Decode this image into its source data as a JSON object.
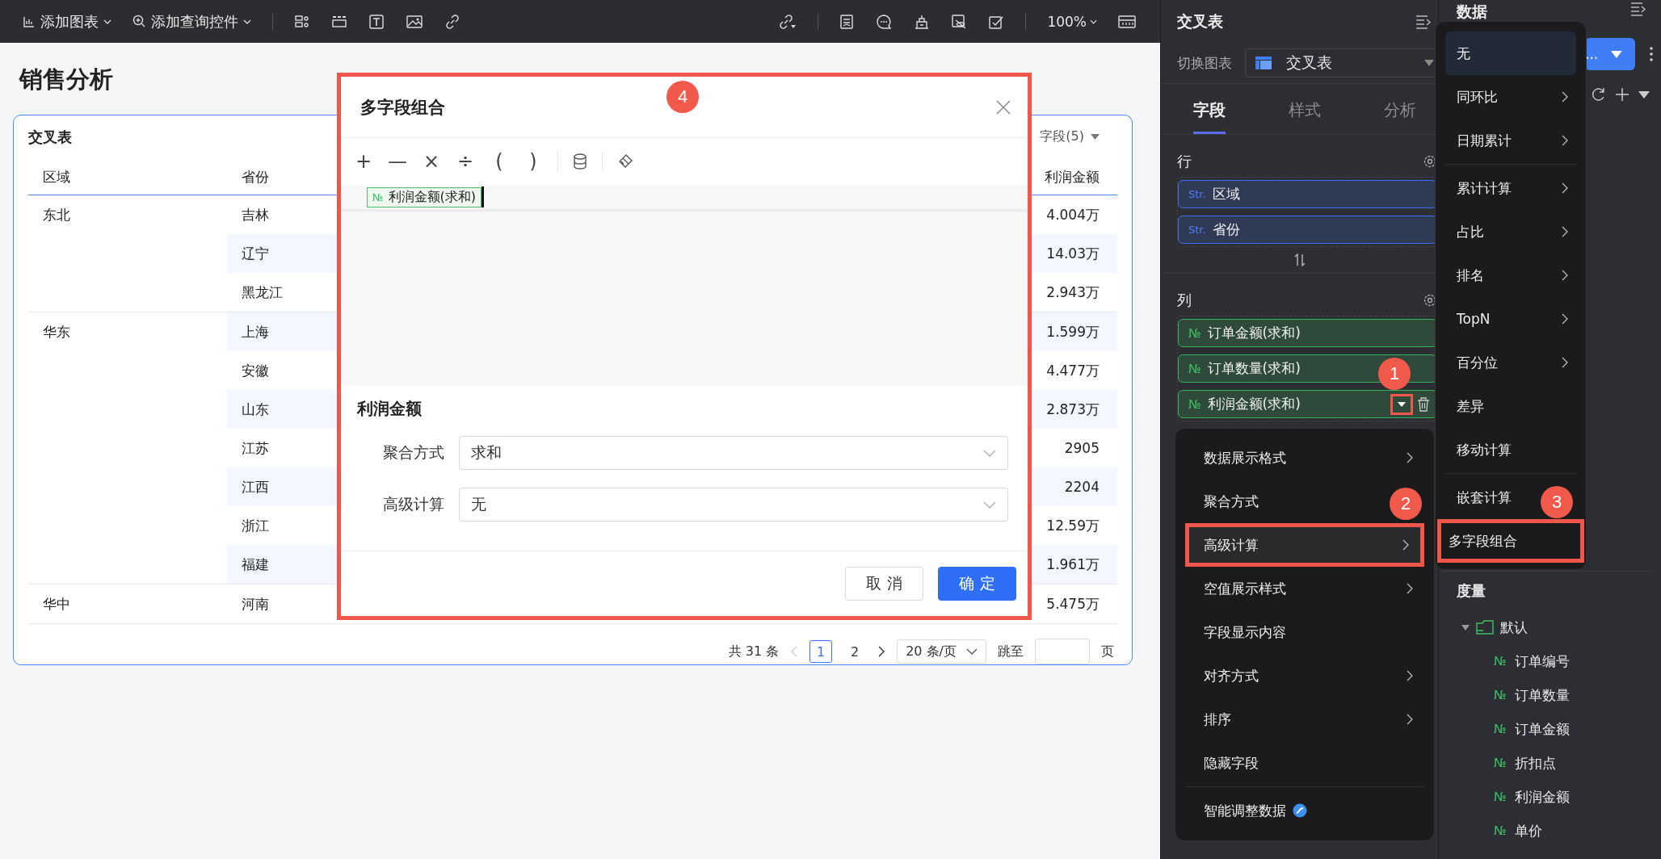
{
  "toolbar": {
    "menus": [
      {
        "label": "添加图表",
        "kind": "chart"
      },
      {
        "label": "添加查询控件",
        "kind": "query"
      }
    ],
    "zoom": "100%"
  },
  "page_title": "销售分析",
  "card": {
    "title": "交叉表",
    "field_picker": "字段(5)",
    "columns": [
      "区域",
      "省份",
      "利润金额"
    ],
    "groups": [
      {
        "region": "东北",
        "rows": [
          {
            "province": "吉林",
            "value": "4.004万"
          },
          {
            "province": "辽宁",
            "value": "14.03万"
          },
          {
            "province": "黑龙江",
            "value": "2.943万"
          }
        ]
      },
      {
        "region": "华东",
        "rows": [
          {
            "province": "上海",
            "value": "1.599万"
          },
          {
            "province": "安徽",
            "value": "4.477万"
          },
          {
            "province": "山东",
            "value": "2.873万"
          },
          {
            "province": "江苏",
            "value": "2905"
          },
          {
            "province": "江西",
            "value": "2204"
          },
          {
            "province": "浙江",
            "value": "12.59万"
          },
          {
            "province": "福建",
            "value": "1.961万"
          }
        ]
      },
      {
        "region": "华中",
        "rows": [
          {
            "province": "河南",
            "value": "5.475万"
          }
        ]
      }
    ],
    "pagination": {
      "total": "共 31 条",
      "pages": [
        {
          "label": "1",
          "selected": true
        },
        {
          "label": "2",
          "selected": false
        }
      ],
      "page_size": "20 条/页",
      "jump": "跳至",
      "unit": "页"
    }
  },
  "dialog": {
    "title": "多字段组合",
    "outlined": true,
    "operators": [
      "+",
      "—",
      "×",
      "÷",
      "(",
      ")"
    ],
    "token": {
      "type": "№",
      "name": "利润金额(求和)"
    },
    "section": "利润金额",
    "fields": [
      {
        "label": "聚合方式",
        "value": "求和"
      },
      {
        "label": "高级计算",
        "value": "无"
      }
    ],
    "buttons": [
      {
        "label": "取 消",
        "kind": "default"
      },
      {
        "label": "确 定",
        "kind": "primary"
      }
    ]
  },
  "field_panel": {
    "title": "交叉表",
    "switch_label": "切换图表",
    "chart_type": "交叉表",
    "tabs": [
      {
        "label": "字段",
        "selected": true
      },
      {
        "label": "样式",
        "selected": false
      },
      {
        "label": "分析",
        "selected": false
      }
    ],
    "rows_label": "行",
    "rows": [
      {
        "type": "Str.",
        "name": "区域"
      },
      {
        "type": "Str.",
        "name": "省份"
      }
    ],
    "columns_label": "列",
    "columns": [
      {
        "type": "№",
        "name": "订单金额(求和)",
        "menu_open": false
      },
      {
        "type": "№",
        "name": "订单数量(求和)",
        "menu_open": false
      },
      {
        "type": "№",
        "name": "利润金额(求和)",
        "menu_open": true
      }
    ]
  },
  "context_menu": {
    "items": [
      {
        "label": "数据展示格式",
        "submenu": true,
        "selected": false,
        "kind": "plain"
      },
      {
        "label": "聚合方式",
        "submenu": false,
        "selected": false,
        "kind": "plain"
      },
      {
        "label": "高级计算",
        "submenu": true,
        "selected": true,
        "kind": "plain"
      },
      {
        "label": "空值展示样式",
        "submenu": true,
        "selected": false,
        "kind": "plain"
      },
      {
        "label": "字段显示内容",
        "submenu": false,
        "selected": false,
        "kind": "plain"
      },
      {
        "label": "对齐方式",
        "submenu": true,
        "selected": false,
        "kind": "plain"
      },
      {
        "label": "排序",
        "submenu": true,
        "selected": false,
        "kind": "plain"
      },
      {
        "label": "隐藏字段",
        "submenu": false,
        "selected": false,
        "kind": "plain"
      },
      {
        "label": "智能调整数据",
        "submenu": false,
        "selected": false,
        "kind": "ai"
      }
    ]
  },
  "submenu": {
    "groups": [
      [
        {
          "label": "无",
          "submenu": false,
          "selected": true
        },
        {
          "label": "同环比",
          "submenu": true,
          "selected": false
        },
        {
          "label": "日期累计",
          "submenu": true,
          "selected": false
        }
      ],
      [
        {
          "label": "累计计算",
          "submenu": true,
          "selected": false
        },
        {
          "label": "占比",
          "submenu": true,
          "selected": false
        },
        {
          "label": "排名",
          "submenu": true,
          "selected": false
        },
        {
          "label": "TopN",
          "submenu": true,
          "selected": false
        },
        {
          "label": "百分位",
          "submenu": true,
          "selected": false
        },
        {
          "label": "差异",
          "submenu": false,
          "selected": false
        },
        {
          "label": "移动计算",
          "submenu": false,
          "selected": false
        }
      ],
      [
        {
          "label": "嵌套计算",
          "submenu": false,
          "selected": false
        },
        {
          "label": "多字段组合",
          "submenu": false,
          "selected": false,
          "outlined": true
        }
      ]
    ]
  },
  "data_panel": {
    "title": "数据",
    "button": "...",
    "section": "度量",
    "folder": "默认",
    "fields": [
      {
        "type": "№",
        "name": "订单编号"
      },
      {
        "type": "№",
        "name": "订单数量"
      },
      {
        "type": "№",
        "name": "订单金额"
      },
      {
        "type": "№",
        "name": "折扣点"
      },
      {
        "type": "№",
        "name": "利润金额"
      },
      {
        "type": "№",
        "name": "单价"
      }
    ]
  },
  "annotations": [
    {
      "label": "1"
    },
    {
      "label": "2"
    },
    {
      "label": "3"
    },
    {
      "label": "4"
    }
  ]
}
